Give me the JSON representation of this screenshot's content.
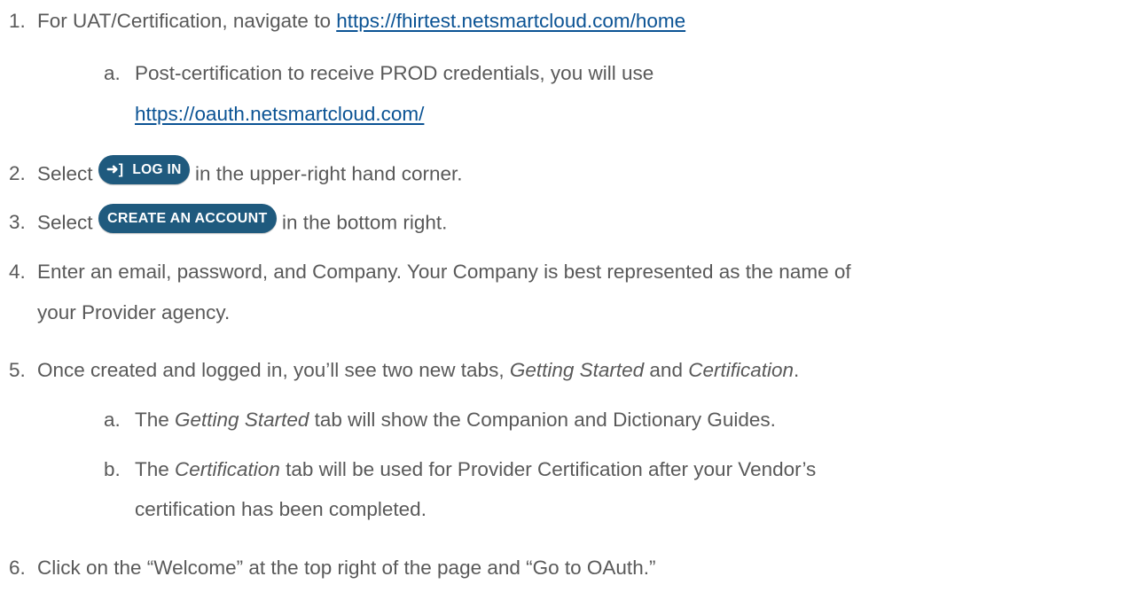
{
  "steps": {
    "s1": {
      "num": "1.",
      "text": "For UAT/Certification, navigate to ",
      "link": "https://fhirtest.netsmartcloud.com/home"
    },
    "s1a": {
      "num": "a.",
      "text": "Post-certification to receive PROD credentials, you will use",
      "link": "https://oauth.netsmartcloud.com/"
    },
    "s2": {
      "num": "2.",
      "pre": "Select ",
      "button": "LOG IN",
      "post": " in the upper-right hand corner."
    },
    "s3": {
      "num": "3.",
      "pre": "Select ",
      "button": "CREATE AN ACCOUNT",
      "post": " in the bottom right."
    },
    "s4": {
      "num": "4.",
      "line1": "Enter an email, password, and Company. Your Company is best represented as the name of",
      "line2": "your Provider agency."
    },
    "s5": {
      "num": "5.",
      "pre": "Once created and logged in, you’ll see two new tabs, ",
      "em1": "Getting Started",
      "mid": " and ",
      "em2": "Certification",
      "post": "."
    },
    "s5a": {
      "num": "a.",
      "pre": "The ",
      "em": "Getting Started",
      "post": " tab will show the Companion and Dictionary Guides."
    },
    "s5b": {
      "num": "b.",
      "pre": "The ",
      "em": "Certification",
      "post": " tab will be used for Provider Certification after your Vendor’s",
      "line2": "certification has been completed."
    },
    "s6": {
      "num": "6.",
      "text": "Click on the “Welcome” at the top right of the page and “Go to OAuth.”"
    }
  },
  "icons": {
    "login": "login-arrow-icon"
  },
  "colors": {
    "text": "#595959",
    "link": "#0b5394",
    "button": "#1f5a7e"
  }
}
